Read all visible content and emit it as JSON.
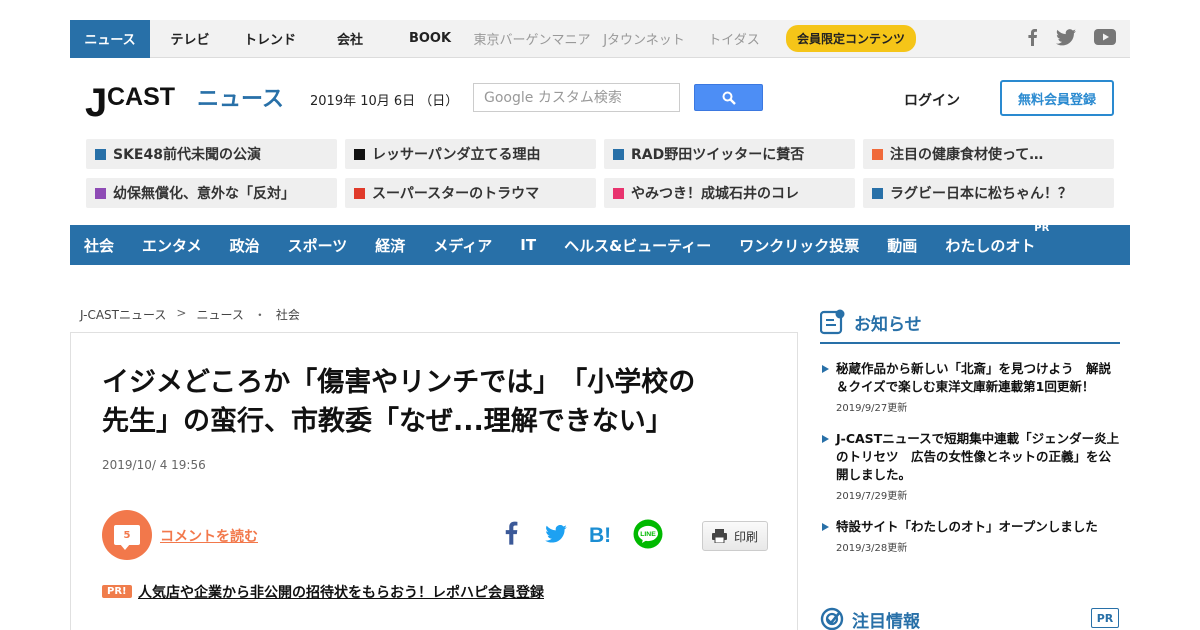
{
  "topnav": {
    "items": [
      "ニュース",
      "テレビ",
      "トレンド",
      "会社",
      "BOOK"
    ],
    "sub_items": [
      "東京バーゲンマニア",
      "Jタウンネット",
      "トイダス"
    ],
    "members_label": "会員限定コンテンツ"
  },
  "header": {
    "logo_j": "J",
    "logo_cast": "CAST",
    "logo_news": "ニュース",
    "date": "2019年 10月 6日 （日）",
    "search_placeholder": "Google カスタム検索",
    "login_label": "ログイン",
    "register_label": "無料会員登録"
  },
  "trending": [
    {
      "text": "SKE48前代未聞の公演",
      "color": "#2870a8"
    },
    {
      "text": "レッサーパンダ立てる理由",
      "color": "#111111"
    },
    {
      "text": "RAD野田ツイッターに賛否",
      "color": "#2870a8"
    },
    {
      "text": "注目の健康食材使って…",
      "color": "#f06a3a"
    },
    {
      "text": "幼保無償化、意外な「反対」",
      "color": "#8e4bb5"
    },
    {
      "text": "スーパースターのトラウマ",
      "color": "#e03a2a"
    },
    {
      "text": "やみつき！成城石井のコレ",
      "color": "#e8336e"
    },
    {
      "text": "ラグビー日本に松ちゃん！？",
      "color": "#2870a8"
    }
  ],
  "categories": [
    "社会",
    "エンタメ",
    "政治",
    "スポーツ",
    "経済",
    "メディア",
    "IT",
    "ヘルス&ビューティー",
    "ワンクリック投票",
    "動画",
    "わたしのオト"
  ],
  "category_pr": "PR",
  "breadcrumb": [
    "J-CASTニュース",
    "ニュース",
    "社会"
  ],
  "breadcrumb_seps": [
    ">",
    "・"
  ],
  "article": {
    "headline_line1": "イジメどころか「傷害やリンチでは」　「小学校の",
    "headline_line2": "先生」の蛮行、市教委「なぜ...理解できない」",
    "date": "2019/10/ 4 19:56",
    "comment_count": "5",
    "comment_label": "コメントを読む",
    "share_hatena": "B!",
    "share_line": "LINE",
    "print_label": "印刷",
    "pr_badge": "PR!",
    "pr_text": "人気店や企業から非公開の招待状をもらおう！レポハピ会員登録"
  },
  "sidebar": {
    "notices_title": "お知らせ",
    "notices": [
      {
        "text": "秘蔵作品から新しい「北斎」を見つけよう　解説＆クイズで楽しむ東洋文庫新連載第1回更新！",
        "date": "2019/9/27更新"
      },
      {
        "text": "J-CASTニュースで短期集中連載「ジェンダー炎上のトリセツ　広告の女性像とネットの正義」を公開しました。",
        "date": "2019/7/29更新"
      },
      {
        "text": "特設サイト「わたしのオト」オープンしました",
        "date": "2019/3/28更新"
      }
    ],
    "attention_title": "注目情報",
    "attention_pr": "PR"
  },
  "colors": {
    "brand_blue": "#2870a8",
    "accent_orange": "#f2784b",
    "members_yellow": "#f5c518",
    "search_blue": "#4d8ef5"
  },
  "icons": [
    "facebook-icon",
    "twitter-icon",
    "youtube-icon",
    "search-icon",
    "comment-icon",
    "hatena-bookmark-icon",
    "line-icon",
    "printer-icon",
    "notice-icon",
    "attention-icon"
  ]
}
